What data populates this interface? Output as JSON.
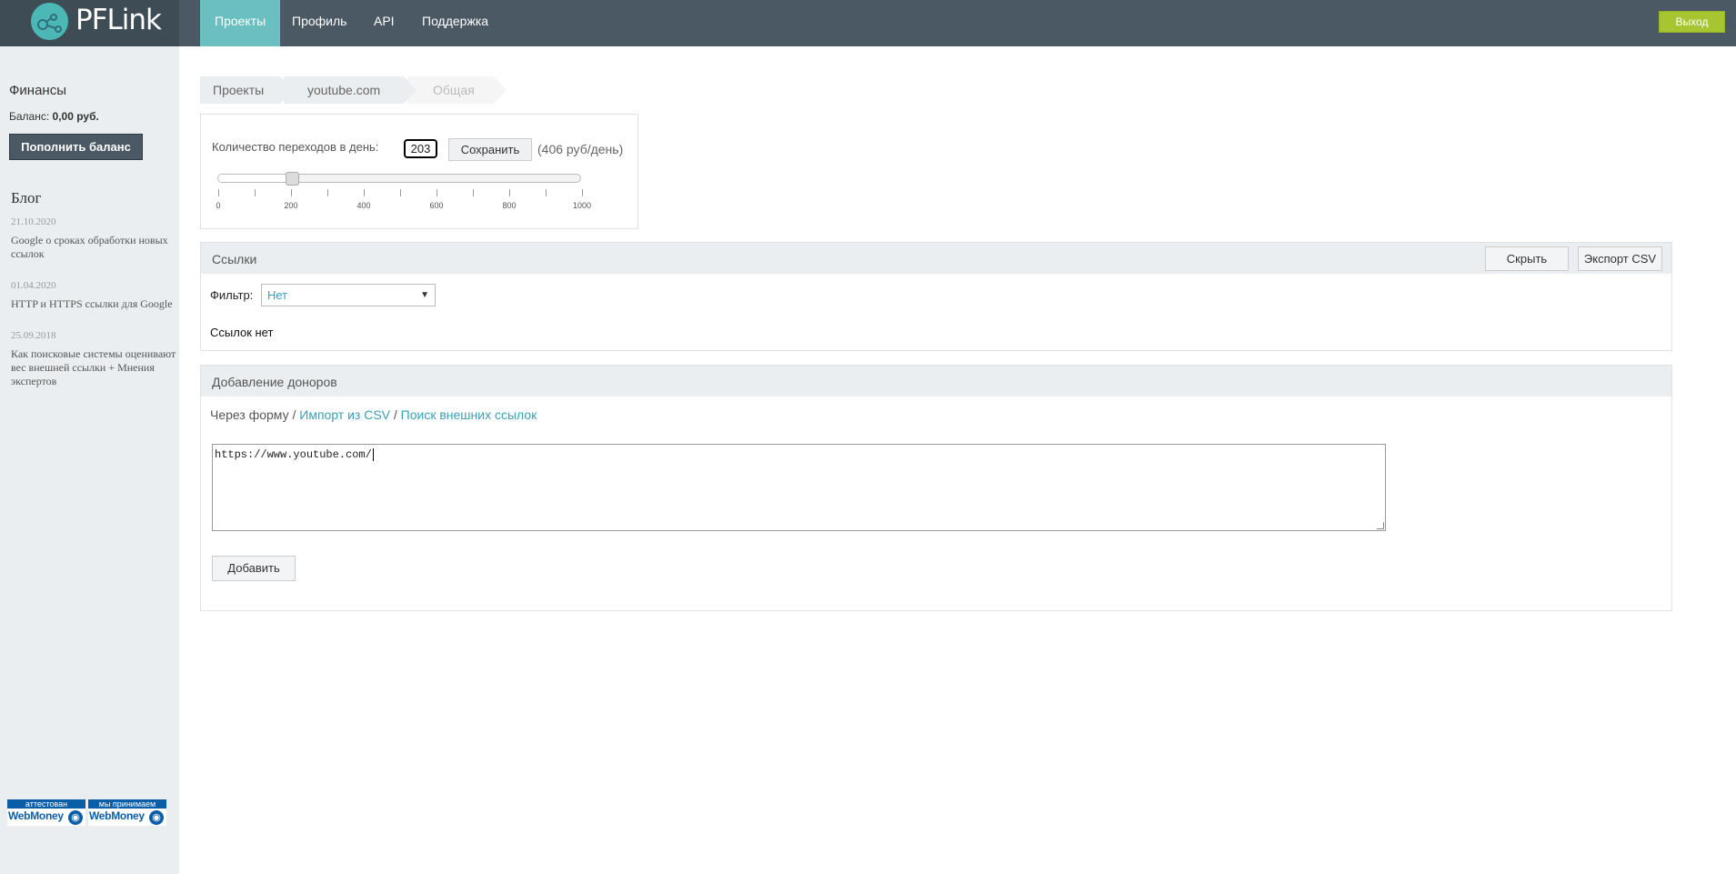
{
  "brand": {
    "name": "PFLink"
  },
  "nav": {
    "items": [
      {
        "label": "Проекты",
        "active": true
      },
      {
        "label": "Профиль"
      },
      {
        "label": "API"
      },
      {
        "label": "Поддержка"
      }
    ],
    "logout": "Выход"
  },
  "sidebar": {
    "finance_title": "Финансы",
    "balance_label": "Баланс:",
    "balance_value": "0,00 руб.",
    "topup_button": "Пополнить баланс",
    "blog_title": "Блог",
    "posts": [
      {
        "date": "21.10.2020",
        "title": "Google о сроках обработки новых ссылок"
      },
      {
        "date": "01.04.2020",
        "title": "HTTP и HTTPS ссылки для Google"
      },
      {
        "date": "25.09.2018",
        "title": "Как поисковые системы оценивают вес внешней ссылки + Мнения экспертов"
      }
    ],
    "badges": [
      {
        "top": "аттестован",
        "bottom": "WebMoney"
      },
      {
        "top": "мы принимаем",
        "bottom": "WebMoney"
      }
    ]
  },
  "breadcrumbs": [
    "Проекты",
    "youtube.com",
    "Общая"
  ],
  "clicks_panel": {
    "label": "Количество переходов в день:",
    "value": "203",
    "save_button": "Сохранить",
    "price": "(406 руб/день)",
    "slider": {
      "min": 0,
      "max": 1000,
      "value": 203,
      "tick_labels": [
        "0",
        "200",
        "400",
        "600",
        "800",
        "1000"
      ]
    }
  },
  "links_panel": {
    "title": "Ссылки",
    "hide_button": "Скрыть",
    "export_button": "Экспорт CSV",
    "filter_label": "Фильтр:",
    "filter_value": "Нет",
    "empty_text": "Ссылок нет"
  },
  "donors_panel": {
    "title": "Добавление доноров",
    "method_form": "Через форму",
    "separator": " / ",
    "method_csv": "Импорт из CSV",
    "method_search": "Поиск внешних ссылок",
    "textarea_value": "https://www.youtube.com/",
    "add_button": "Добавить"
  }
}
